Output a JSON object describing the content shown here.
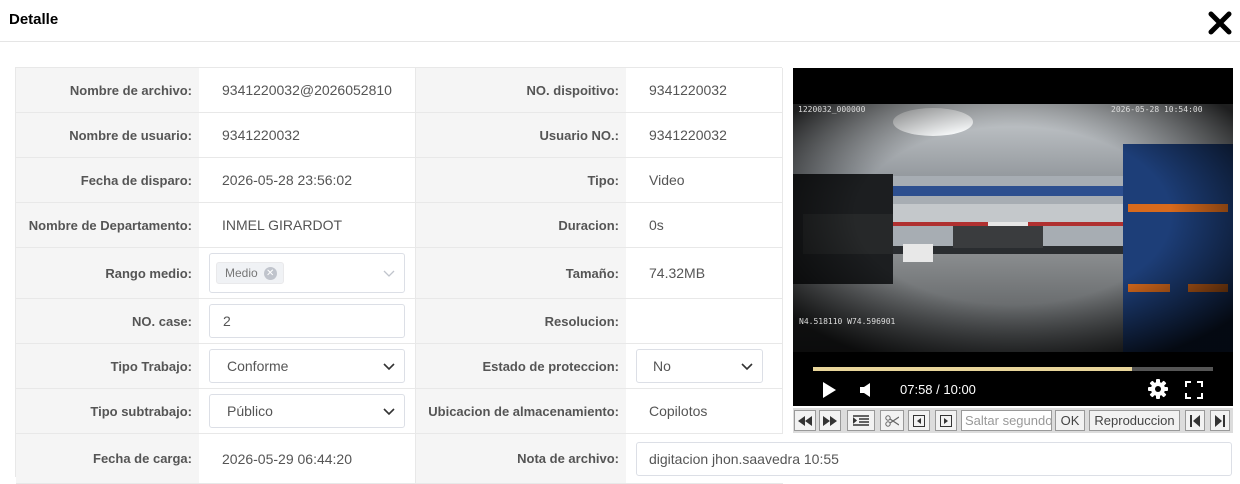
{
  "dialog": {
    "title": "Detalle"
  },
  "fields": {
    "nombre_archivo": {
      "label": "Nombre de archivo:",
      "value": "9341220032@2026052810"
    },
    "no_dispositivo": {
      "label": "NO. dispoitivo:",
      "value": "9341220032"
    },
    "nombre_usuario": {
      "label": "Nombre de usuario:",
      "value": "9341220032"
    },
    "usuario_no": {
      "label": "Usuario NO.:",
      "value": "9341220032"
    },
    "fecha_disparo": {
      "label": "Fecha de disparo:",
      "value": "2026-05-28 23:56:02"
    },
    "tipo": {
      "label": "Tipo:",
      "value": "Video"
    },
    "departamento": {
      "label": "Nombre de Departamento:",
      "value": "INMEL GIRARDOT"
    },
    "duracion": {
      "label": "Duracion:",
      "value": "0s"
    },
    "rango_medio": {
      "label": "Rango medio:",
      "tag": "Medio"
    },
    "tamano": {
      "label": "Tamaño:",
      "value": "74.32MB"
    },
    "no_case": {
      "label": "NO. case:",
      "value": "2"
    },
    "resolucion": {
      "label": "Resolucion:",
      "value": ""
    },
    "tipo_trabajo": {
      "label": "Tipo Trabajo:",
      "value": "Conforme"
    },
    "estado_proteccion": {
      "label": "Estado de proteccion:",
      "value": "No"
    },
    "tipo_subtrabajo": {
      "label": "Tipo subtrabajo:",
      "value": "Público"
    },
    "ubicacion": {
      "label": "Ubicacion de almacenamiento:",
      "value": "Copilotos"
    },
    "fecha_carga": {
      "label": "Fecha de carga:",
      "value": "2026-05-29 06:44:20"
    },
    "nota_archivo": {
      "label": "Nota de archivo:",
      "value": "digitacion jhon.saavedra 10:55"
    }
  },
  "video": {
    "osd_top_left": "1220032_000000",
    "osd_top_right": "2026-05-28  10:54:00",
    "osd_coords": "N4.518110  W74.596901",
    "time": "07:58 / 10:00",
    "progress": 0.797
  },
  "toolbar": {
    "seek_placeholder": "Saltar segundos",
    "ok_label": "OK",
    "playback_label": "Reproduccion"
  },
  "colors": {
    "progress_fill": "#e8d59a",
    "label_bg": "#f5f5f5"
  }
}
